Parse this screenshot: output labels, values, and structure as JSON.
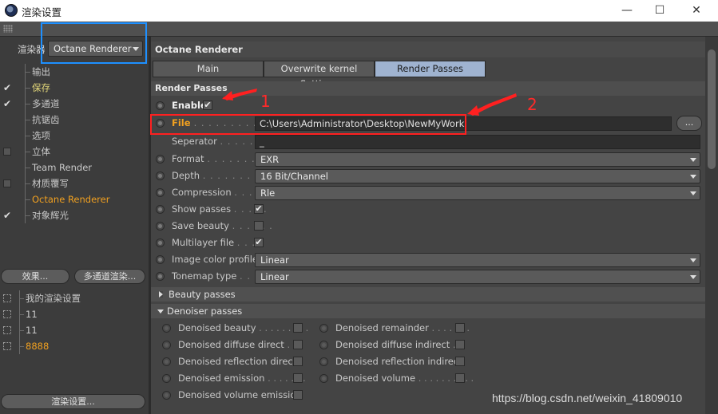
{
  "window": {
    "title": "渲染设置",
    "minimize": "—",
    "maximize": "☐",
    "close": "✕"
  },
  "left": {
    "renderer_label": "渲染器",
    "renderer_value": "Octane Renderer",
    "tree": [
      {
        "label": "输出",
        "check": ""
      },
      {
        "label": "保存",
        "check": "✔",
        "color": "yellow"
      },
      {
        "label": "多通道",
        "check": "✔"
      },
      {
        "label": "抗锯齿",
        "check": ""
      },
      {
        "label": "选项",
        "check": ""
      },
      {
        "label": "立体",
        "check": "box"
      },
      {
        "label": "Team Render",
        "check": ""
      },
      {
        "label": "材质覆写",
        "check": "box"
      },
      {
        "label": "Octane Renderer",
        "check": "",
        "color": "orange"
      },
      {
        "label": "对象辉光",
        "check": "✔"
      }
    ],
    "effects_button": "效果...",
    "multipass_button": "多通道渲染...",
    "presets": [
      {
        "label": "我的渲染设置"
      },
      {
        "label": "11"
      },
      {
        "label": "11"
      },
      {
        "label": "8888",
        "color": "orange"
      }
    ],
    "render_settings_button": "渲染设置..."
  },
  "right": {
    "header": "Octane Renderer",
    "tabs": [
      {
        "label": "Main"
      },
      {
        "label": "Overwrite kernel Settings"
      },
      {
        "label": "Render Passes"
      }
    ],
    "active_tab": "Render Passes",
    "section": "Render Passes",
    "enable_label": "Enable",
    "enable_checked": "✔",
    "file_label": "File",
    "file_dots": ". . . . . . . . . . . . . .",
    "file_value": "C:\\Users\\Administrator\\Desktop\\NewMyWork",
    "browse_label": "...",
    "separator_label": "Seperator",
    "separator_dots": ". . . . . . . .",
    "separator_value": "_",
    "format_label": "Format",
    "format_dots": ". . . . . . . . . . .",
    "format_value": "EXR",
    "depth_label": "Depth",
    "depth_dots": ". . . . . . . . . . .",
    "depth_value": "16 Bit/Channel",
    "compression_label": "Compression",
    "compression_dots": ". . . . .",
    "compression_value": "Rle",
    "show_passes_label": "Show passes",
    "show_passes_dots": ". . . . .",
    "show_passes_checked": "✔",
    "save_beauty_label": "Save beauty",
    "save_beauty_dots": ". . . . . .",
    "multilayer_label": "Multilayer file",
    "multilayer_dots": ". . .",
    "multilayer_checked": "✔",
    "icp_label": "Image color profile",
    "icp_value": "Linear",
    "tonemap_label": "Tonemap type",
    "tonemap_dots": ". . . .",
    "tonemap_value": "Linear",
    "beauty_passes": "Beauty passes",
    "denoiser_passes": "Denoiser passes",
    "denoised_left": [
      {
        "label": "Denoised beauty",
        "dots": ". . . . . . . . ."
      },
      {
        "label": "Denoised diffuse direct",
        "dots": ". . ."
      },
      {
        "label": "Denoised reflection direct",
        "dots": ""
      },
      {
        "label": "Denoised emission",
        "dots": ". . . . . . ."
      },
      {
        "label": "Denoised volume emission",
        "dots": ""
      }
    ],
    "denoised_right": [
      {
        "label": "Denoised remainder",
        "dots": ". . . . . . ."
      },
      {
        "label": "Denoised diffuse indirect",
        "dots": ". ."
      },
      {
        "label": "Denoised reflection indirect",
        "dots": ""
      },
      {
        "label": "Denoised volume",
        "dots": ". . . . . . . . . ."
      }
    ]
  },
  "annotations": {
    "num1": "1",
    "num2": "2",
    "colors": {
      "red": "#ff2020",
      "blue": "#1e90ff",
      "orange": "#f0a020"
    }
  },
  "watermark": "https://blog.csdn.net/weixin_41809010"
}
